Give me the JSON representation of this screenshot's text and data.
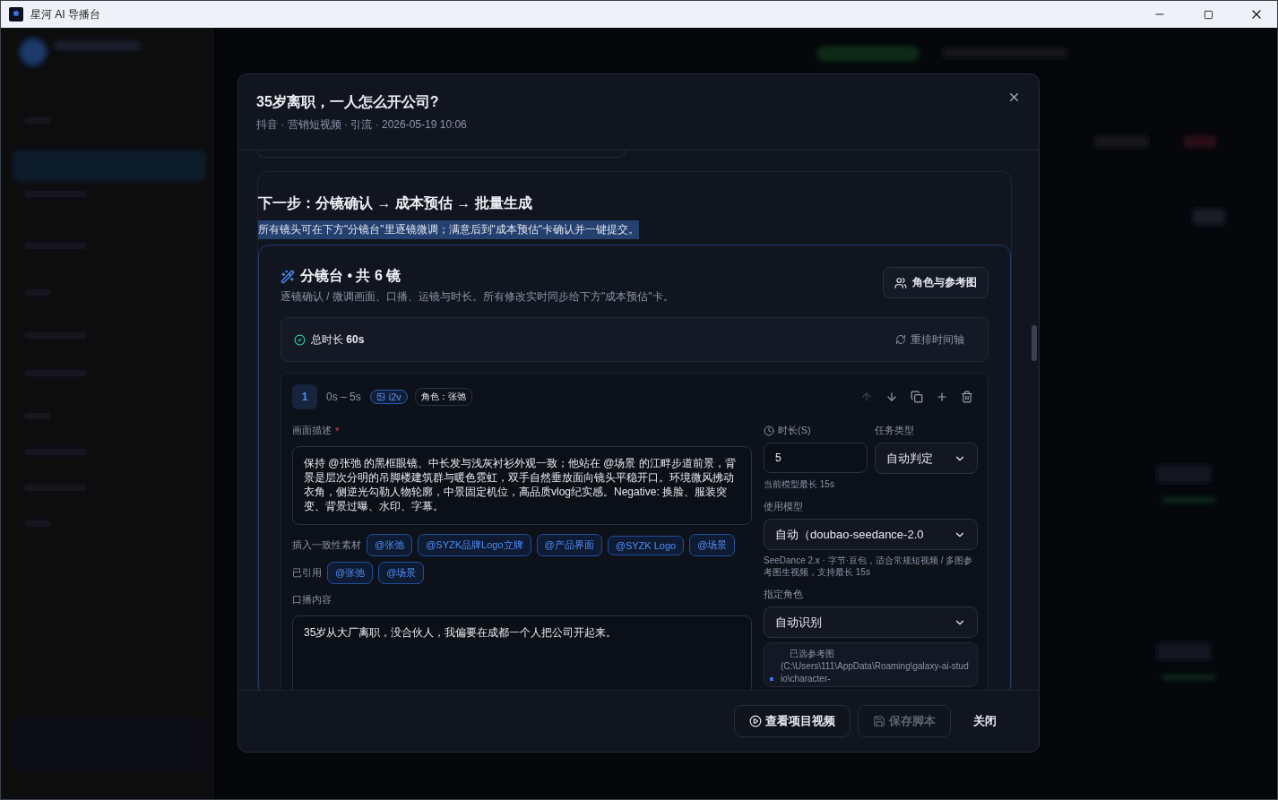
{
  "window": {
    "title": "星河 AI 导播台"
  },
  "dialog": {
    "title": "35岁离职，一人怎么开公司?",
    "meta": "抖音 · 营销短视频 · 引流 · 2026-05-19 10:06"
  },
  "next_step": {
    "title": "下一步：分镜确认 → 成本预估 → 批量生成",
    "note": "所有镜头可在下方\"分镜台\"里逐镜微调；满意后到\"成本预估\"卡确认并一键提交。"
  },
  "storyboard": {
    "title": "分镜台 • 共 6 镜",
    "subtitle": "逐镜确认 / 微调画面、口播、运镜与时长。所有修改实时同步给下方\"成本预估\"卡。",
    "roles_button": "角色与参考图",
    "total_label": "总时长",
    "total_value": "60s",
    "retime_button": "重排时间轴"
  },
  "shot": {
    "index": "1",
    "time": "0s – 5s",
    "mode": "i2v",
    "role_tag": "角色：张弛",
    "actions": [
      {
        "kind": "up",
        "disabled": true
      },
      {
        "kind": "down",
        "disabled": false
      },
      {
        "kind": "copy",
        "disabled": false
      },
      {
        "kind": "add",
        "disabled": false
      },
      {
        "kind": "delete",
        "disabled": false
      }
    ],
    "description_label": "画面描述",
    "required_mark": "*",
    "description": "保持 @张弛 的黑框眼镜、中长发与浅灰衬衫外观一致；他站在 @场景 的江畔步道前景，背景是层次分明的吊脚楼建筑群与暖色霓虹，双手自然垂放面向镜头平稳开口。环境微风拂动衣角，侧逆光勾勒人物轮廓，中景固定机位，高品质vlog纪实感。Negative: 换脸、服装突变、背景过曝、水印、字幕。",
    "insert_label": "插入一致性素材",
    "assets": [
      "@张弛",
      "@SYZK品牌Logo立牌",
      "@产品界面",
      "@SYZK Logo",
      "@场景"
    ],
    "referenced_label": "已引用",
    "referenced": [
      "@张弛",
      "@场景"
    ],
    "voiceover_label": "口播内容",
    "voiceover": "35岁从大厂离职，没合伙人，我偏要在成都一个人把公司开起来。",
    "duration_label": "时长(S)",
    "duration": "5",
    "duration_hint": "当前模型最长 15s",
    "task_type_label": "任务类型",
    "task_type": "自动判定",
    "model_label": "使用模型",
    "model": "自动（doubao-seedance-2.0",
    "model_hint": "SeeDance 2.x · 字节·豆包，适合常规短视频 / 多图参考图生视频，支持最长 15s",
    "role_label": "指定角色",
    "role": "自动识别",
    "reference_title": "已选参考图",
    "reference_path": "(C:\\Users\\111\\AppData\\Roaming\\galaxy-ai-studio\\character-"
  },
  "footer": {
    "buttons": [
      {
        "label": "查看项目视频",
        "kind": "video",
        "disabled": false
      },
      {
        "label": "保存脚本",
        "kind": "save",
        "disabled": true
      },
      {
        "label": "关闭",
        "kind": "plain",
        "disabled": false
      }
    ]
  }
}
